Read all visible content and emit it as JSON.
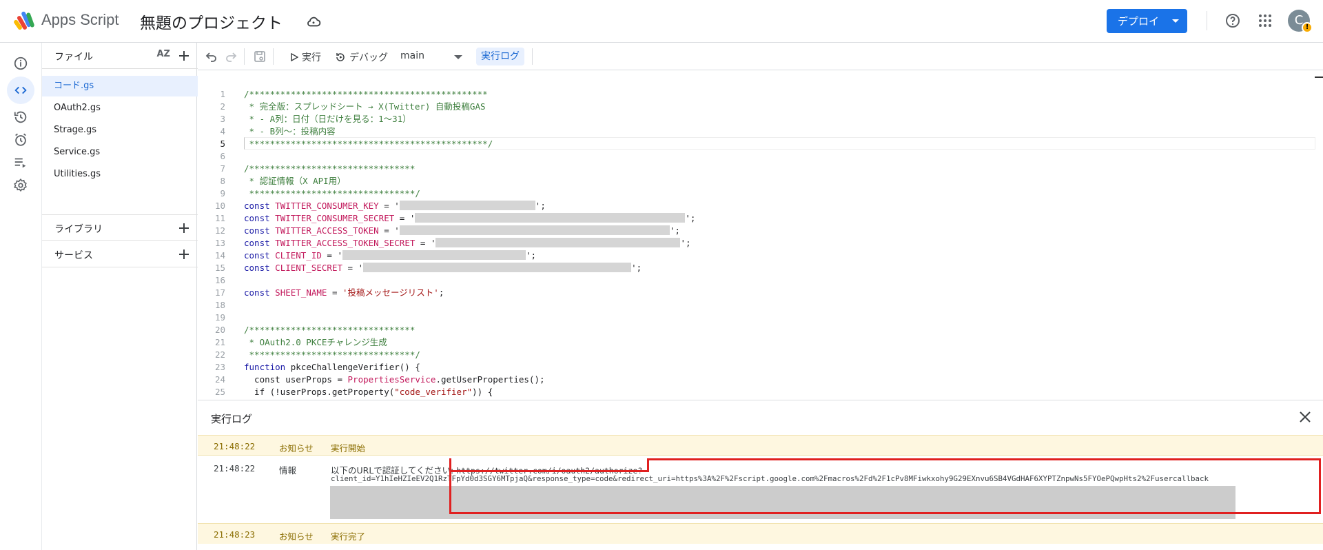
{
  "app": {
    "name": "Apps Script",
    "project_title": "無題のプロジェクト",
    "deploy_label": "デプロイ",
    "avatar_letter": "C",
    "avatar_badge": "!"
  },
  "colors": {
    "accent": "#1a73e8",
    "active_bg": "#e8f0fe",
    "notice_bg": "#fef7e0",
    "highlight_border": "#e02020"
  },
  "rail": {
    "items": [
      {
        "icon": "info-icon"
      },
      {
        "icon": "code-icon"
      },
      {
        "icon": "history-icon"
      },
      {
        "icon": "alarm-icon"
      },
      {
        "icon": "executions-icon"
      },
      {
        "icon": "settings-icon"
      }
    ]
  },
  "files": {
    "header": "ファイル",
    "sort_label": "AZ",
    "items": [
      "コード.gs",
      "OAuth2.gs",
      "Strage.gs",
      "Service.gs",
      "Utilities.gs"
    ],
    "libraries_label": "ライブラリ",
    "services_label": "サービス"
  },
  "toolbar": {
    "run_label": "実行",
    "debug_label": "デバッグ",
    "function_name": "main",
    "log_label": "実行ログ"
  },
  "code": {
    "line_numbers": [
      "1",
      "2",
      "3",
      "4",
      "5",
      "6",
      "7",
      "8",
      "9",
      "10",
      "11",
      "12",
      "13",
      "14",
      "15",
      "16",
      "17",
      "18",
      "19",
      "20",
      "21",
      "22",
      "23",
      "24",
      "25"
    ],
    "l1": "/**********************************************",
    "l2": " * 完全版：スプレッドシート → X(Twitter) 自動投稿GAS",
    "l3": " * - A列：日付（日だけを見る：1〜31）",
    "l4": " * - B列〜：投稿内容",
    "l5": " **********************************************/",
    "l7": "/********************************",
    "l8": " * 認証情報（X API用）",
    "l9": " ********************************/",
    "kw_const": "const",
    "kw_function": "function",
    "eq": " = '",
    "end": "';",
    "k10": "TWITTER_CONSUMER_KEY",
    "k11": "TWITTER_CONSUMER_SECRET",
    "k12": "TWITTER_ACCESS_TOKEN",
    "k13": "TWITTER_ACCESS_TOKEN_SECRET",
    "k14": "CLIENT_ID",
    "k15": "CLIENT_SECRET",
    "k17": "SHEET_NAME",
    "eq17": " = ",
    "v17": "'投稿メッセージリスト'",
    "end17": ";",
    "l20": "/********************************",
    "l21": " * OAuth2.0 PKCEチャレンジ生成",
    "l22": " ********************************/",
    "l23_name": " pkceChallengeVerifier() {",
    "l24_a": "  const userProps = ",
    "l24_b": "PropertiesService",
    "l24_c": ".getUserProperties();",
    "l25_a": "  if (!userProps.getProperty(",
    "l25_b": "\"code_verifier\"",
    "l25_c": ")) {"
  },
  "log": {
    "title": "実行ログ",
    "rows": [
      {
        "time": "21:48:22",
        "level": "お知らせ",
        "message": "実行開始"
      },
      {
        "time": "21:48:22",
        "level": "情報",
        "message": "以下のURLで認証してください: ",
        "url1": "https://twitter.com/i/oauth2/authorize?",
        "url2": "client_id=Y1hIeHZIeEV2Q1RzTFpYd0d3SGY6MTpjaQ&response_type=code&redirect_uri=https%3A%2F%2Fscript.google.com%2Fmacros%2Fd%2F1cPv8MFiwkxohy9G29EXnvu6SB4VGdHAF6XYPTZnpwNs5FYOePQwpHts2%2Fusercallback"
      },
      {
        "time": "21:48:23",
        "level": "お知らせ",
        "message": "実行完了"
      }
    ]
  }
}
